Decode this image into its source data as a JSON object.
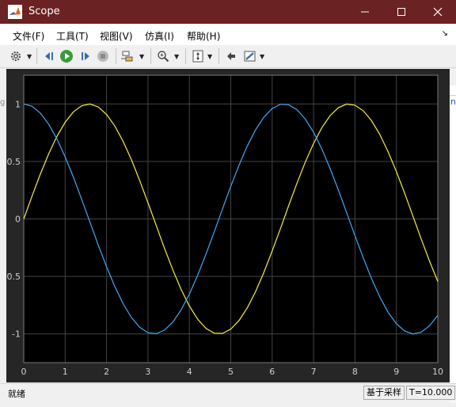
{
  "window": {
    "title": "Scope"
  },
  "menu": {
    "items": [
      "文件(F)",
      "工具(T)",
      "视图(V)",
      "仿真(I)",
      "帮助(H)"
    ]
  },
  "toolbar": {
    "icons": [
      "gear-icon",
      "step-back-icon",
      "run-icon",
      "step-forward-icon",
      "stop-icon",
      "signal-select-icon",
      "zoom-icon",
      "autoscale-icon",
      "highlight-block-icon",
      "style-icon"
    ]
  },
  "colors": {
    "titlebar": "#6b2222",
    "plot_bg": "#000000",
    "axes_frame_bg": "#262626",
    "grid": "#444444",
    "series_cos": "#3fa9f5",
    "series_sin": "#f7ef3a"
  },
  "chart_data": {
    "type": "line",
    "x_range": [
      0,
      10
    ],
    "ylim": [
      -1.25,
      1.25
    ],
    "xticks": [
      "0",
      "1",
      "2",
      "3",
      "4",
      "5",
      "6",
      "7",
      "8",
      "9",
      "10"
    ],
    "yticks": [
      "1",
      "0.5",
      "0",
      "-0.5",
      "-1"
    ],
    "grid": true,
    "series": [
      {
        "color": "#f7ef3a",
        "x": [
          0,
          0.2,
          0.4,
          0.6,
          0.8,
          1.0,
          1.2,
          1.4,
          1.6,
          1.8,
          2.0,
          2.2,
          2.4,
          2.6,
          2.8,
          3.0,
          3.2,
          3.4,
          3.6,
          3.8,
          4.0,
          4.2,
          4.4,
          4.6,
          4.8,
          5.0,
          5.2,
          5.4,
          5.6,
          5.8,
          6.0,
          6.2,
          6.4,
          6.6,
          6.8,
          7.0,
          7.2,
          7.4,
          7.6,
          7.8,
          8.0,
          8.2,
          8.4,
          8.6,
          8.8,
          9.0,
          9.2,
          9.4,
          9.6,
          9.8,
          10.0
        ],
        "y": [
          0,
          0.199,
          0.389,
          0.565,
          0.717,
          0.841,
          0.932,
          0.985,
          1.0,
          0.974,
          0.909,
          0.808,
          0.675,
          0.516,
          0.335,
          0.141,
          -0.058,
          -0.256,
          -0.443,
          -0.612,
          -0.757,
          -0.872,
          -0.952,
          -0.994,
          -0.996,
          -0.959,
          -0.883,
          -0.773,
          -0.631,
          -0.465,
          -0.279,
          -0.083,
          0.117,
          0.312,
          0.494,
          0.657,
          0.794,
          0.899,
          0.968,
          0.999,
          0.989,
          0.941,
          0.855,
          0.734,
          0.585,
          0.412,
          0.223,
          0.025,
          -0.175,
          -0.366,
          -0.544
        ]
      },
      {
        "color": "#3fa9f5",
        "x": [
          0,
          0.2,
          0.4,
          0.6,
          0.8,
          1.0,
          1.2,
          1.4,
          1.6,
          1.8,
          2.0,
          2.2,
          2.4,
          2.6,
          2.8,
          3.0,
          3.2,
          3.4,
          3.6,
          3.8,
          4.0,
          4.2,
          4.4,
          4.6,
          4.8,
          5.0,
          5.2,
          5.4,
          5.6,
          5.8,
          6.0,
          6.2,
          6.4,
          6.6,
          6.8,
          7.0,
          7.2,
          7.4,
          7.6,
          7.8,
          8.0,
          8.2,
          8.4,
          8.6,
          8.8,
          9.0,
          9.2,
          9.4,
          9.6,
          9.8,
          10.0
        ],
        "y": [
          1.0,
          0.98,
          0.921,
          0.825,
          0.697,
          0.54,
          0.362,
          0.17,
          -0.029,
          -0.227,
          -0.416,
          -0.589,
          -0.737,
          -0.857,
          -0.942,
          -0.99,
          -0.998,
          -0.967,
          -0.897,
          -0.791,
          -0.654,
          -0.49,
          -0.307,
          -0.113,
          0.087,
          0.284,
          0.469,
          0.635,
          0.776,
          0.886,
          0.96,
          0.997,
          0.993,
          0.95,
          0.869,
          0.754,
          0.608,
          0.438,
          0.251,
          0.054,
          -0.146,
          -0.339,
          -0.519,
          -0.679,
          -0.811,
          -0.911,
          -0.975,
          -1.0,
          -0.985,
          -0.93,
          -0.839
        ]
      }
    ]
  },
  "status": {
    "left": "就绪",
    "mode": "基于采样",
    "time": "T=10.000"
  },
  "background_fragments": {
    "left": "g",
    "right": "n"
  }
}
